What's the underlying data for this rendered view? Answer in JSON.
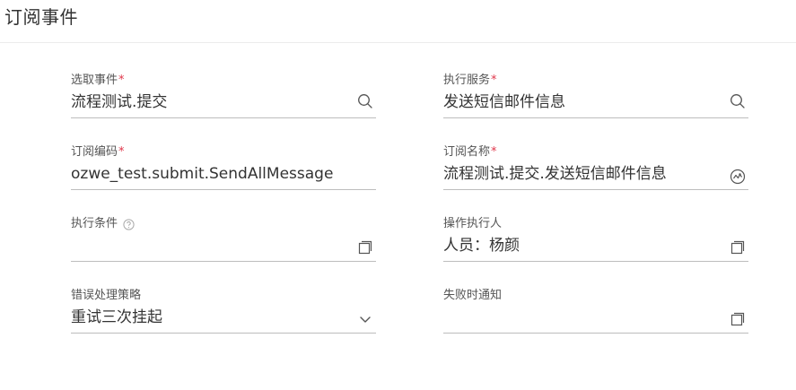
{
  "header": {
    "title": "订阅事件"
  },
  "form": {
    "select_event": {
      "label": "选取事件",
      "required": "*",
      "value": "流程测试.提交"
    },
    "exec_service": {
      "label": "执行服务",
      "required": "*",
      "value": "发送短信邮件信息"
    },
    "sub_code": {
      "label": "订阅编码",
      "required": "*",
      "value": "ozwe_test.submit.SendAllMessage"
    },
    "sub_name": {
      "label": "订阅名称",
      "required": "*",
      "value": "流程测试.提交.发送短信邮件信息"
    },
    "exec_condition": {
      "label": "执行条件",
      "value": ""
    },
    "operator": {
      "label": "操作执行人",
      "value": "人员：杨颜"
    },
    "error_strategy": {
      "label": "错误处理策略",
      "value": "重试三次挂起"
    },
    "fail_notify": {
      "label": "失败时通知",
      "value": ""
    }
  },
  "icons": {
    "search": "search-icon",
    "globe": "translate-globe-icon",
    "expand": "expand-dialog-icon",
    "chevron": "chevron-down-icon",
    "help": "help-circle-icon"
  },
  "colors": {
    "required": "#e0364a",
    "underline": "#bdbdbd",
    "text": "#333333"
  }
}
